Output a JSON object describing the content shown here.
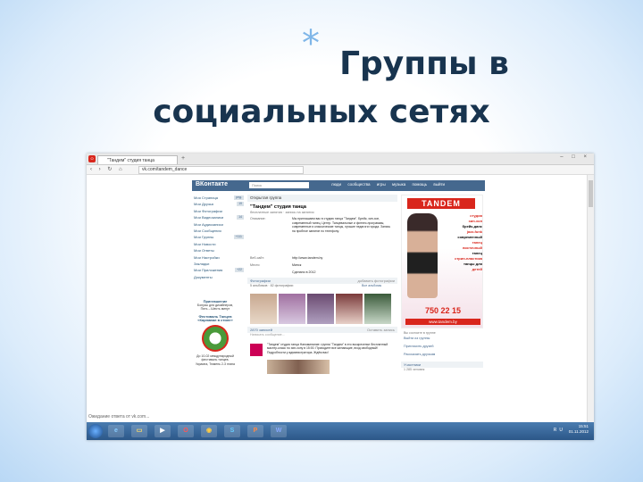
{
  "slide": {
    "star": "*",
    "title_line1": "Группы в",
    "title_line2": "социальных сетях"
  },
  "browser": {
    "tab_title": "\"Тандем\" студия танца",
    "opera_label": "О",
    "url": "vk.com/tandem_dance",
    "nav_icons": "‹ › ↻ ⌂",
    "window_controls": "– □ ×"
  },
  "vk": {
    "logo": "ВКонтакте",
    "search_placeholder": "Поиск",
    "menu": [
      "люди",
      "сообщества",
      "игры",
      "музыка",
      "помощь",
      "выйти"
    ],
    "left_menu": [
      {
        "label": "Моя Страница",
        "count": "ред."
      },
      {
        "label": "Мои Друзья",
        "count": "19"
      },
      {
        "label": "Мои Фотографии",
        "count": ""
      },
      {
        "label": "Мои Видеозаписи",
        "count": "14"
      },
      {
        "label": "Мои Аудиозаписи",
        "count": ""
      },
      {
        "label": "Мои Сообщения",
        "count": ""
      },
      {
        "label": "Мои Группы",
        "count": "+111"
      },
      {
        "label": "Мои Новости",
        "count": ""
      },
      {
        "label": "Мои Ответы",
        "count": ""
      },
      {
        "label": "Мои Настройки",
        "count": ""
      },
      {
        "label": "Закладки",
        "count": ""
      },
      {
        "label": "Мои Приложения",
        "count": "+22"
      },
      {
        "label": "Документы",
        "count": ""
      }
    ],
    "left_ad": {
      "title": "Приглашение",
      "text": "Бонусы для дизайнеров, Пять – Шесть минут",
      "title2": "Фестиваль Танцев «Карнавал в стиле»",
      "text2": "До 10-02 международный фестиваль танцев. Украина, Тюмень 2-3 этапа"
    },
    "group": {
      "header": "Открытая группа",
      "name": "\"Тандем\" студия танца",
      "subtitle": "бесплатные занятия · запись на занятия",
      "desc_label": "Описание:",
      "description": "Мы приглашаем вас в студию танца \"Тандем\". Брейк, хип-хоп, современный танец. Центр. Танцевальные и фитнес-программы, современные и классические танцы, лучшие педагоги города. Запись на пробное занятие по телефону.",
      "site_label": "Веб-сайт:",
      "site": "http://www.tandem.by",
      "place_label": "Место:",
      "place": "Минск",
      "date_label": "",
      "date": "Сделано в 2012"
    },
    "photos": {
      "section": "Фотографии",
      "action": "добавить фотографии",
      "album_count": "5 альбомов · 82 фотографии",
      "all": "Все альбомы"
    },
    "wall": {
      "section": "2870 записей",
      "action": "Оставить запись",
      "placeholder": "Написать сообщение...",
      "post": "\"Тандем\" студия танца Напоминание: группа \"Тандем\" в это воскресенье бесплатный мастер-класс по хип-хопу в 15:00. Приходите все желающие, вход свободный! Подробности у администратора. Ждём вас!"
    },
    "banner": {
      "brand": "TANDEM",
      "lines": [
        "студия",
        "хип-хоп",
        "брейк-данс",
        "jazz-funk",
        "современный",
        "танец",
        "восточный",
        "танец",
        "стрип-пластика",
        "танцы для",
        "детей"
      ],
      "phone": "750 22 15",
      "site": "www.tandem.by"
    },
    "right_links": [
      "Вы состоите в группе",
      "Выйти из группы",
      "Пригласить друзей",
      "Рассказать друзьям",
      "Участники",
      "1 285 человек"
    ]
  },
  "bottom_note": "Ожидание ответа от vk.com...",
  "taskbar": {
    "icons": [
      "ie-icon",
      "folder-icon",
      "media-icon",
      "opera-icon",
      "chrome-icon",
      "skype-icon",
      "pdf-icon",
      "word-icon"
    ],
    "tray_time": "15:51",
    "tray_date": "01.11.2012",
    "tray_lang": "RU"
  }
}
